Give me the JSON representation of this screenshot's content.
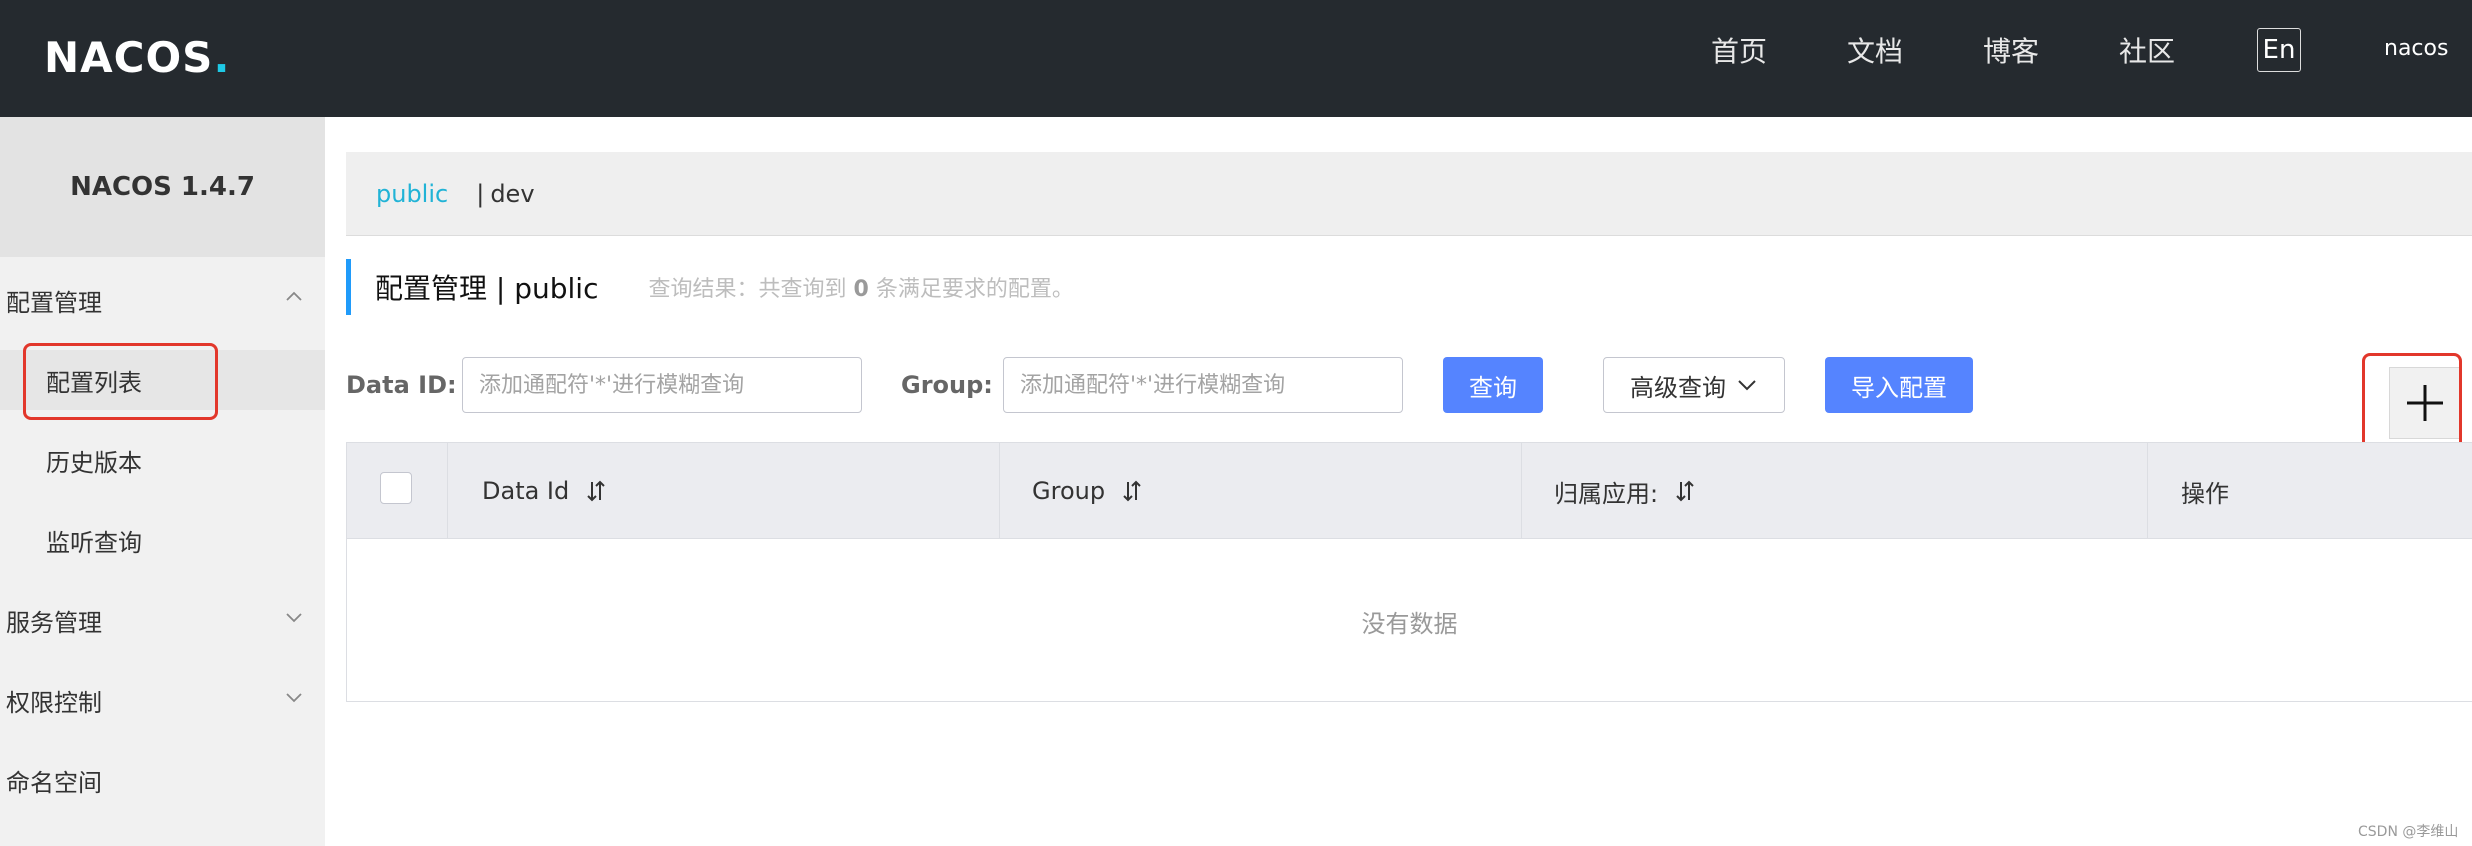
{
  "header": {
    "logo_text": "NACOS.",
    "nav": [
      "首页",
      "文档",
      "博客",
      "社区"
    ],
    "lang_button": "En",
    "user": "nacos"
  },
  "sidebar": {
    "title": "NACOS 1.4.7",
    "groups": [
      {
        "label": "配置管理",
        "expanded": true,
        "items": [
          "配置列表",
          "历史版本",
          "监听查询"
        ]
      },
      {
        "label": "服务管理",
        "expanded": false
      },
      {
        "label": "权限控制",
        "expanded": false
      },
      {
        "label": "命名空间"
      }
    ],
    "active_item": "配置列表"
  },
  "namespaces": {
    "active": "public",
    "separator": "|",
    "other": "dev"
  },
  "page": {
    "title": "配置管理  |  public",
    "result_prefix": "查询结果：共查询到",
    "result_count": "0",
    "result_suffix": "条满足要求的配置。"
  },
  "filters": {
    "data_id_label": "Data ID:",
    "data_id_placeholder": "添加通配符'*'进行模糊查询",
    "group_label": "Group:",
    "group_placeholder": "添加通配符'*'进行模糊查询",
    "query_button": "查询",
    "advanced_button": "高级查询",
    "import_button": "导入配置",
    "add_button": "+"
  },
  "table": {
    "columns": [
      "Data Id",
      "Group",
      "归属应用:",
      "操作"
    ],
    "rows": [],
    "empty_text": "没有数据"
  },
  "watermark": "CSDN @李维山",
  "colors": {
    "header_bg": "#252a2f",
    "primary": "#5584ff",
    "link": "#21b3d6",
    "highlight_box": "#e2372b"
  }
}
